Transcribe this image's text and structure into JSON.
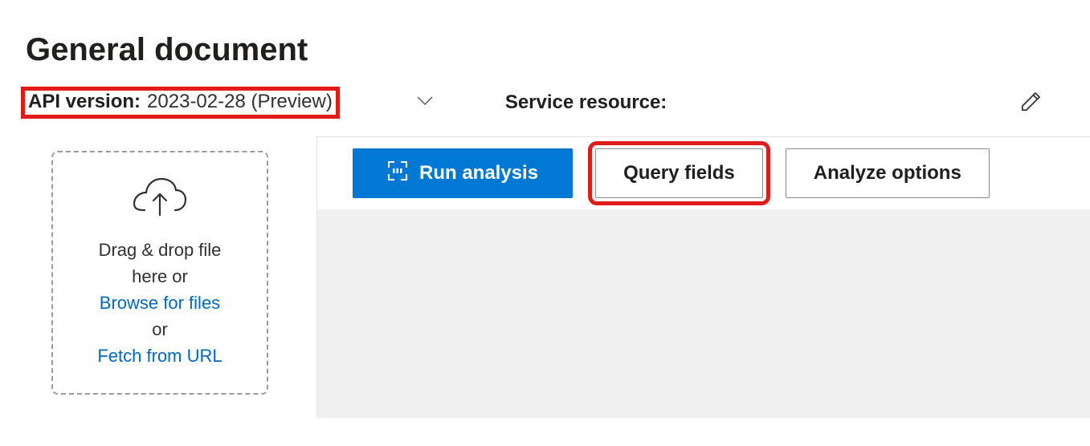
{
  "page": {
    "title": "General document"
  },
  "api_version": {
    "label": "API version:",
    "value": "2023-02-28 (Preview)"
  },
  "service_resource": {
    "label": "Service resource:"
  },
  "upload": {
    "drag_drop_line1": "Drag & drop file",
    "drag_drop_line2": "here or",
    "browse_link": "Browse for files",
    "or_text": "or",
    "fetch_link": "Fetch from URL"
  },
  "toolbar": {
    "run_analysis": "Run analysis",
    "query_fields": "Query fields",
    "analyze_options": "Analyze options"
  }
}
